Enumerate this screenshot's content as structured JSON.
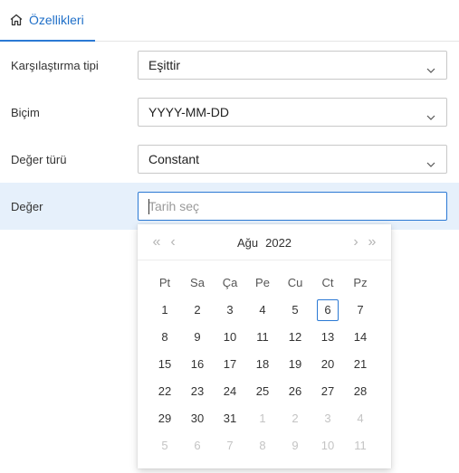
{
  "tab": {
    "label": "Özellikleri",
    "icon": "home-icon"
  },
  "fields": {
    "comparison_type": {
      "label": "Karşılaştırma tipi",
      "value": "Eşittir"
    },
    "format": {
      "label": "Biçim",
      "value": "YYYY-MM-DD"
    },
    "value_type": {
      "label": "Değer türü",
      "value": "Constant"
    },
    "value": {
      "label": "Değer",
      "placeholder": "Tarih seç",
      "value": ""
    }
  },
  "calendar": {
    "month": "Ağu",
    "year": "2022",
    "nav": {
      "prev_year": "«",
      "prev_month": "‹",
      "next_month": "›",
      "next_year": "»"
    },
    "weekdays": [
      "Pt",
      "Sa",
      "Ça",
      "Pe",
      "Cu",
      "Ct",
      "Pz"
    ],
    "weeks": [
      [
        {
          "d": "1"
        },
        {
          "d": "2"
        },
        {
          "d": "3"
        },
        {
          "d": "4"
        },
        {
          "d": "5"
        },
        {
          "d": "6",
          "today": true
        },
        {
          "d": "7"
        }
      ],
      [
        {
          "d": "8"
        },
        {
          "d": "9"
        },
        {
          "d": "10"
        },
        {
          "d": "11"
        },
        {
          "d": "12"
        },
        {
          "d": "13"
        },
        {
          "d": "14"
        }
      ],
      [
        {
          "d": "15"
        },
        {
          "d": "16"
        },
        {
          "d": "17"
        },
        {
          "d": "18"
        },
        {
          "d": "19"
        },
        {
          "d": "20"
        },
        {
          "d": "21"
        }
      ],
      [
        {
          "d": "22"
        },
        {
          "d": "23"
        },
        {
          "d": "24"
        },
        {
          "d": "25"
        },
        {
          "d": "26"
        },
        {
          "d": "27"
        },
        {
          "d": "28"
        }
      ],
      [
        {
          "d": "29"
        },
        {
          "d": "30"
        },
        {
          "d": "31"
        },
        {
          "d": "1",
          "other": true
        },
        {
          "d": "2",
          "other": true
        },
        {
          "d": "3",
          "other": true
        },
        {
          "d": "4",
          "other": true
        }
      ],
      [
        {
          "d": "5",
          "other": true
        },
        {
          "d": "6",
          "other": true
        },
        {
          "d": "7",
          "other": true
        },
        {
          "d": "8",
          "other": true
        },
        {
          "d": "9",
          "other": true
        },
        {
          "d": "10",
          "other": true
        },
        {
          "d": "11",
          "other": true
        }
      ]
    ]
  },
  "colors": {
    "accent": "#2b79d4",
    "active_row_bg": "#e6f0fb",
    "muted_day": "#c4c4c4"
  }
}
